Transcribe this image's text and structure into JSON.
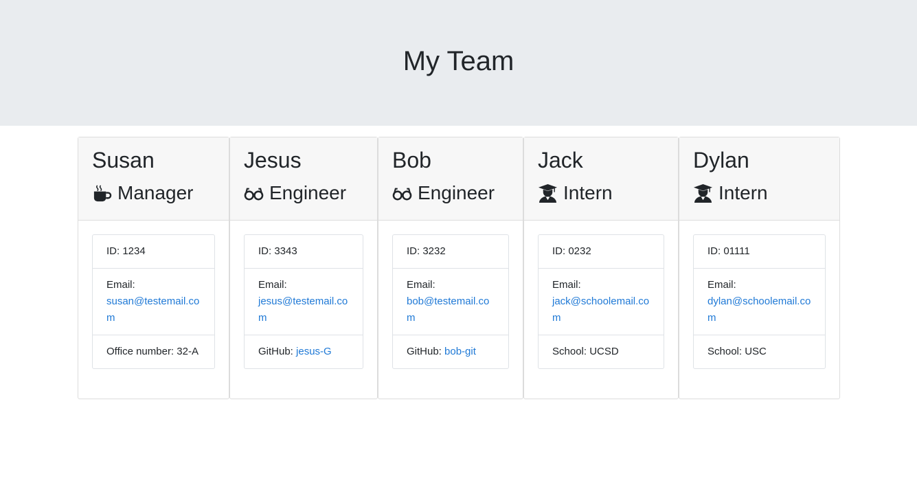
{
  "header": {
    "title": "My Team"
  },
  "colors": {
    "link": "#1f79d6",
    "jumbotron": "#e9ecef",
    "card_header": "#f7f7f7"
  },
  "employees": [
    {
      "name": "Susan",
      "role": "Manager",
      "icon": "coffee-icon",
      "id_label": "ID: 1234",
      "email_label": "Email:",
      "email": "susan@testemail.com",
      "extra_label": "Office number: 32-A",
      "extra_link": ""
    },
    {
      "name": "Jesus",
      "role": "Engineer",
      "icon": "glasses-icon",
      "id_label": "ID: 3343",
      "email_label": "Email:",
      "email": "jesus@testemail.com",
      "extra_label": "GitHub: ",
      "extra_link": "jesus-G"
    },
    {
      "name": "Bob",
      "role": "Engineer",
      "icon": "glasses-icon",
      "id_label": "ID: 3232",
      "email_label": "Email:",
      "email": "bob@testemail.com",
      "extra_label": "GitHub: ",
      "extra_link": "bob-git"
    },
    {
      "name": "Jack",
      "role": "Intern",
      "icon": "graduate-icon",
      "id_label": "ID: 0232",
      "email_label": "Email:",
      "email": "jack@schoolemail.com",
      "extra_label": "School: UCSD",
      "extra_link": ""
    },
    {
      "name": "Dylan",
      "role": "Intern",
      "icon": "graduate-icon",
      "id_label": "ID: 01111",
      "email_label": "Email:",
      "email": "dylan@schoolemail.com",
      "extra_label": "School: USC",
      "extra_link": ""
    }
  ]
}
